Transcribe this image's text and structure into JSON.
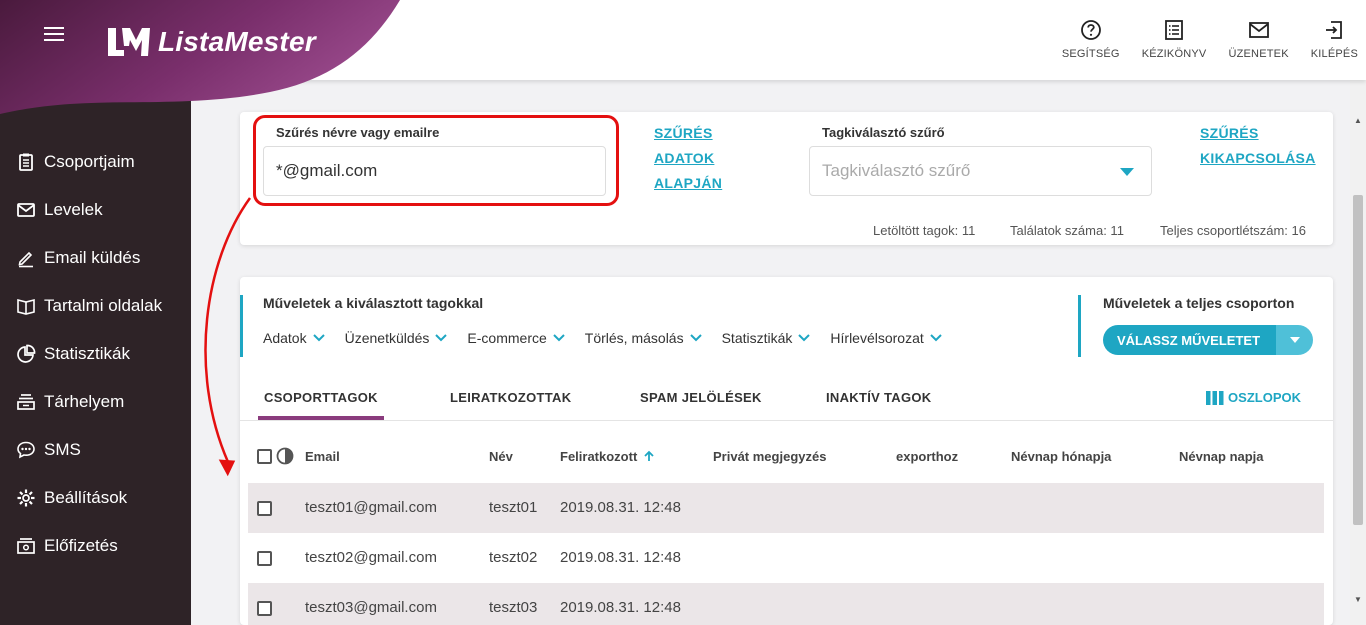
{
  "brand": {
    "name": "ListaMester"
  },
  "top_actions": [
    {
      "label": "SEGÍTSÉG",
      "icon": "help-icon"
    },
    {
      "label": "KÉZIKÖNYV",
      "icon": "manual-icon"
    },
    {
      "label": "ÜZENETEK",
      "icon": "mail-icon"
    },
    {
      "label": "KILÉPÉS",
      "icon": "logout-icon"
    }
  ],
  "sidebar": {
    "items": [
      {
        "label": "Csoportjaim",
        "icon": "clipboard-icon"
      },
      {
        "label": "Levelek",
        "icon": "envelope-icon"
      },
      {
        "label": "Email küldés",
        "icon": "pen-icon"
      },
      {
        "label": "Tartalmi oldalak",
        "icon": "book-icon"
      },
      {
        "label": "Statisztikák",
        "icon": "pie-chart-icon"
      },
      {
        "label": "Tárhelyem",
        "icon": "storage-icon"
      },
      {
        "label": "SMS",
        "icon": "sms-icon"
      },
      {
        "label": "Beállítások",
        "icon": "gear-icon"
      },
      {
        "label": "Előfizetés",
        "icon": "subscription-icon"
      }
    ]
  },
  "filter": {
    "name_email_label": "Szűrés névre vagy emailre",
    "name_email_value": "*@gmail.com",
    "by_data_link": [
      "SZŰRÉS",
      "ADATOK",
      "ALAPJÁN"
    ],
    "member_filter_label": "Tagkiválasztó szűrő",
    "member_filter_placeholder": "Tagkiválasztó szűrő",
    "disable_link": [
      "SZŰRÉS",
      "KIKAPCSOLÁSA"
    ],
    "stats": {
      "loaded": "Letöltött tagok: 11",
      "results": "Találatok száma: 11",
      "total": "Teljes csoportlétszám: 16"
    }
  },
  "operations": {
    "selected_title": "Műveletek a kiválasztott tagokkal",
    "selected_menus": [
      "Adatok",
      "Üzenetküldés",
      "E-commerce",
      "Törlés, másolás",
      "Statisztikák",
      "Hírlevélsorozat"
    ],
    "group_title": "Műveletek a teljes csoporton",
    "group_button": "VÁLASSZ MŰVELETET"
  },
  "tabs": [
    {
      "label": "CSOPORTTAGOK",
      "active": true
    },
    {
      "label": "LEIRATKOZOTTAK",
      "active": false
    },
    {
      "label": "SPAM JELÖLÉSEK",
      "active": false
    },
    {
      "label": "INAKTÍV TAGOK",
      "active": false
    }
  ],
  "columns_button": "OSZLOPOK",
  "table": {
    "headers": [
      "Email",
      "Név",
      "Feliratkozott",
      "Privát megjegyzés",
      "exporthoz",
      "Névnap hónapja",
      "Névnap napja"
    ],
    "sort_column": "Feliratkozott",
    "rows": [
      {
        "email": "teszt01@gmail.com",
        "name": "teszt01",
        "subscribed": "2019.08.31. 12:48"
      },
      {
        "email": "teszt02@gmail.com",
        "name": "teszt02",
        "subscribed": "2019.08.31. 12:48"
      },
      {
        "email": "teszt03@gmail.com",
        "name": "teszt03",
        "subscribed": "2019.08.31. 12:48"
      }
    ]
  },
  "colors": {
    "accent": "#1ea6c3",
    "sidebar": "#2e2327",
    "brand_purple": "#8a3b7d",
    "highlight_red": "#e41010"
  }
}
